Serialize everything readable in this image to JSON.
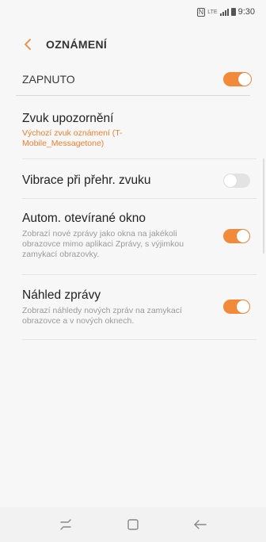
{
  "status_bar": {
    "nfc": "N",
    "network": "LTE",
    "time": "9:30"
  },
  "header": {
    "title": "OZNÁMENÍ",
    "back_icon": "chevron-left-icon"
  },
  "master": {
    "label": "ZAPNUTO",
    "enabled": true
  },
  "settings": [
    {
      "title": "Zvuk upozornění",
      "subtitle": "Výchozí zvuk oznámení (T-Mobile_Messagetone)"
    },
    {
      "title": "Vibrace při přehr. zvuku",
      "enabled": false
    },
    {
      "title": "Autom. otevírané okno",
      "subtitle": "Zobrazí nové zprávy jako okna na jakékoli obrazovce mimo aplikaci Zprávy, s výjimkou zamykací obrazovky.",
      "enabled": true
    },
    {
      "title": "Náhled zprávy",
      "subtitle": "Zobrazí náhledy nových zpráv na zamykací obrazovce a v nových oknech.",
      "enabled": true
    }
  ],
  "nav": {
    "recents_icon": "recents-icon",
    "home_icon": "home-icon",
    "back_icon": "back-arrow-icon"
  },
  "colors": {
    "accent": "#f28a3a",
    "subtitle_accent": "#f0802e",
    "toggle_off": "#e3e3e3"
  }
}
